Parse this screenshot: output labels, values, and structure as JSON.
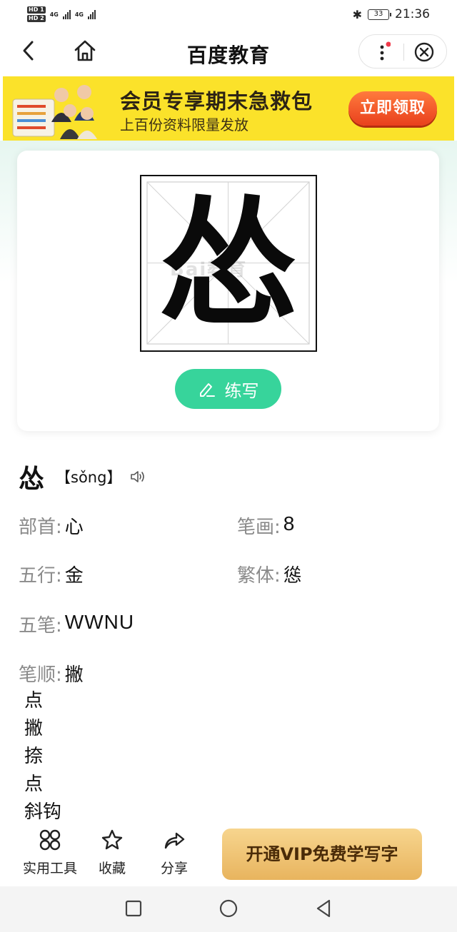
{
  "status_bar": {
    "sim1": "HD 1",
    "sim2": "HD 2",
    "net1": "4G",
    "net2": "4G",
    "battery": "33",
    "time": "21:36"
  },
  "nav": {
    "title": "百度教育"
  },
  "banner": {
    "title": "会员专享期末急救包",
    "subtitle": "上百份资料限量发放",
    "button": "立即领取"
  },
  "character": {
    "glyph": "怂",
    "watermark": "Bai教育",
    "practice_label": "练写",
    "pinyin": "【sǒng】"
  },
  "info": {
    "radical_label": "部首:",
    "radical": "心",
    "strokes_label": "笔画:",
    "strokes": "8",
    "wuxing_label": "五行:",
    "wuxing": "金",
    "traditional_label": "繁体:",
    "traditional": "慫",
    "wubi_label": "五笔:",
    "wubi": "WWNU",
    "order_label": "笔顺:",
    "order": [
      "撇",
      "点",
      "撇",
      "捺",
      "点",
      "斜钩"
    ]
  },
  "toolbar": {
    "tools_label": "实用工具",
    "favorite_label": "收藏",
    "share_label": "分享",
    "vip_label": "开通VIP免费学写字"
  },
  "colors": {
    "banner_bg": "#fbe22a",
    "banner_button": "#e9401d",
    "practice_button": "#37d49b",
    "vip_button": "#e8b45e",
    "label_gray": "#8a8a8a"
  }
}
